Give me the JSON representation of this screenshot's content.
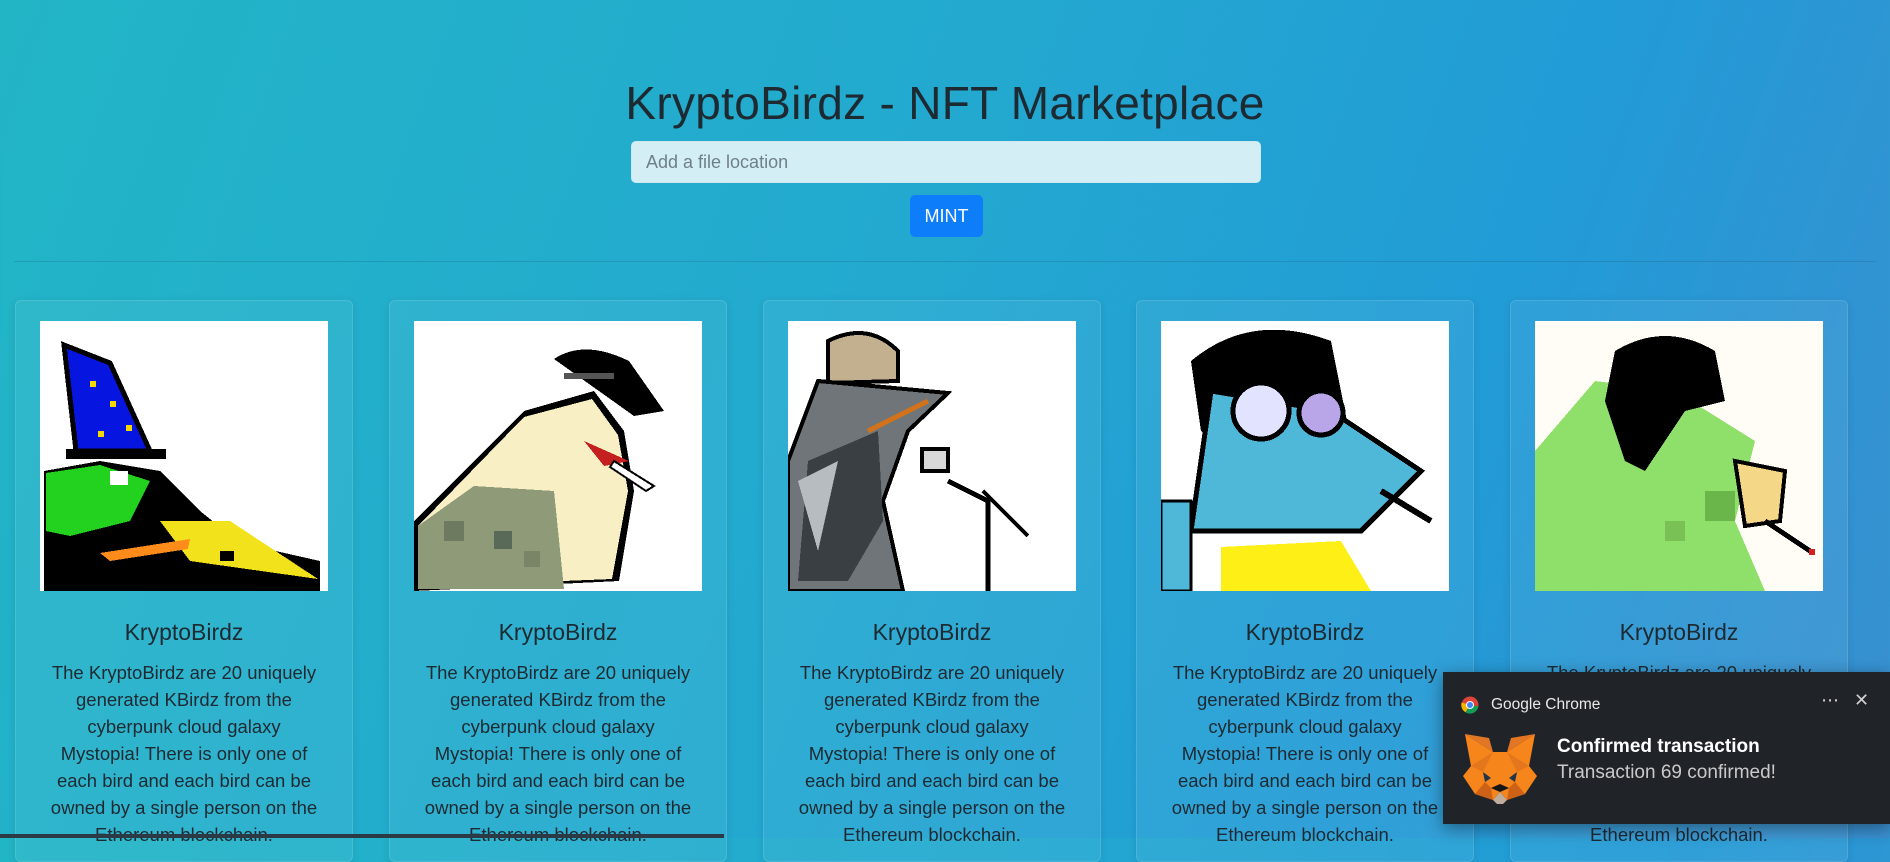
{
  "header": {
    "title": "KryptoBirdz - NFT Marketplace",
    "file_input_placeholder": "Add a file location",
    "mint_label": "MINT"
  },
  "cards": [
    {
      "name": "KryptoBirdz",
      "description": "The KryptoBirdz are 20 uniquely generated KBirdz from the cyberpunk cloud galaxy Mystopia! There is only one of each bird and each bird can be owned by a single person on the Ethereum blockchain.",
      "icon": "wizard-hat-bird"
    },
    {
      "name": "KryptoBirdz",
      "description": "The KryptoBirdz are 20 uniquely generated KBirdz from the cyberpunk cloud galaxy Mystopia! There is only one of each bird and each bird can be owned by a single person on the Ethereum blockchain.",
      "icon": "bowler-hat-bird"
    },
    {
      "name": "KryptoBirdz",
      "description": "The KryptoBirdz are 20 uniquely generated KBirdz from the cyberpunk cloud galaxy Mystopia! There is only one of each bird and each bird can be owned by a single person on the Ethereum blockchain.",
      "icon": "microphone-bird"
    },
    {
      "name": "KryptoBirdz",
      "description": "The KryptoBirdz are 20 uniquely generated KBirdz from the cyberpunk cloud galaxy Mystopia! There is only one of each bird and each bird can be owned by a single person on the Ethereum blockchain.",
      "icon": "goggles-bird"
    },
    {
      "name": "KryptoBirdz",
      "description": "The KryptoBirdz are 20 uniquely generated KBirdz from the cyberpunk cloud galaxy Mystopia! There is only one of each bird and each bird can be owned by a single person on the Ethereum blockchain.",
      "icon": "green-parrot-bird"
    }
  ],
  "notification": {
    "app_name": "Google Chrome",
    "title": "Confirmed transaction",
    "message": "Transaction 69 confirmed!",
    "app_icon": "chrome-icon",
    "image_icon": "metamask-fox-icon"
  },
  "colors": {
    "accent": "#0d7dfa",
    "background_start": "#22b5c6",
    "background_end": "#3a8fd0",
    "toast_bg": "#202428"
  }
}
